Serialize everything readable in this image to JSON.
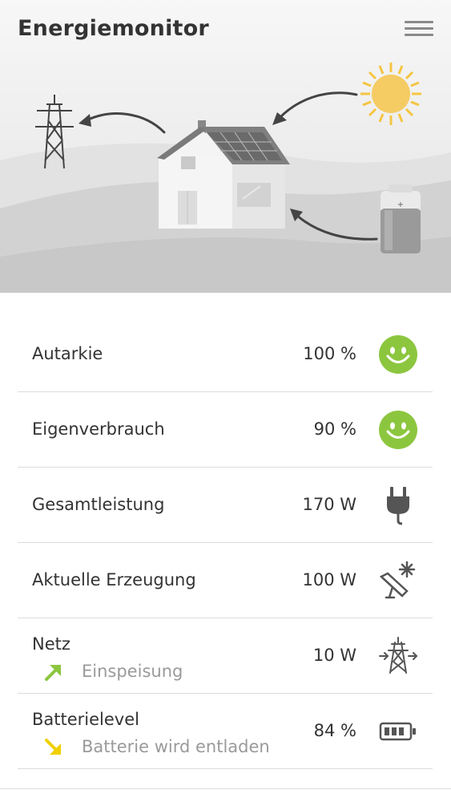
{
  "header": {
    "title": "Energiemonitor"
  },
  "colors": {
    "accent_green": "#8cc63f",
    "arrow_green": "#8cc63f",
    "arrow_yellow": "#f0d000"
  },
  "rows": [
    {
      "label": "Autarkie",
      "value": "100 %",
      "icon": "smiley-icon"
    },
    {
      "label": "Eigenverbrauch",
      "value": "90 %",
      "icon": "smiley-icon"
    },
    {
      "label": "Gesamtleistung",
      "value": "170 W",
      "icon": "plug-icon"
    },
    {
      "label": "Aktuelle Erzeugung",
      "value": "100 W",
      "icon": "solar-panel-icon"
    },
    {
      "label": "Netz",
      "sub": "Einspeisung",
      "value": "10 W",
      "icon": "power-tower-icon",
      "arrow": "arrow-up-right-icon"
    },
    {
      "label": "Batterielevel",
      "sub": "Batterie wird entladen",
      "value": "84 %",
      "icon": "battery-icon",
      "arrow": "arrow-down-right-icon"
    }
  ]
}
